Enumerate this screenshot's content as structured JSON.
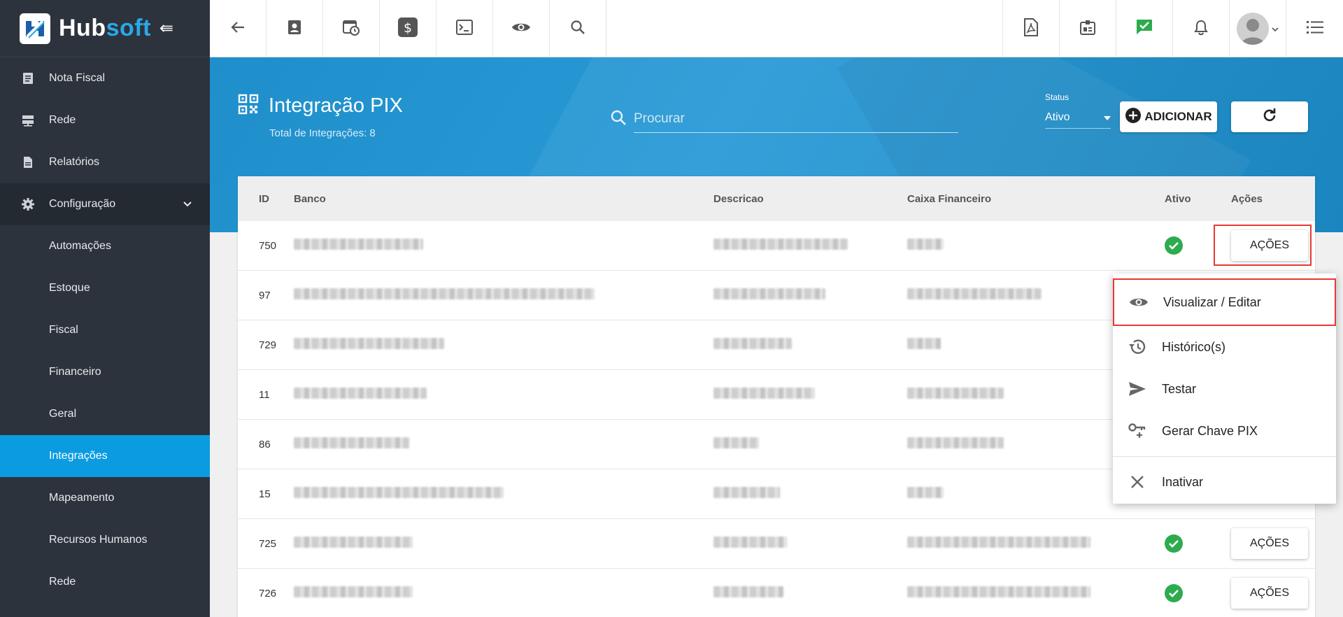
{
  "brand": {
    "name_part1": "Hub",
    "name_part2": "soft"
  },
  "sidebar": {
    "items": [
      {
        "label": "Nota Fiscal",
        "icon": "invoice-icon"
      },
      {
        "label": "Rede",
        "icon": "server-icon"
      },
      {
        "label": "Relatórios",
        "icon": "report-icon"
      },
      {
        "label": "Configuração",
        "icon": "gear-icon"
      }
    ],
    "subitems": [
      {
        "label": "Automações"
      },
      {
        "label": "Estoque"
      },
      {
        "label": "Fiscal"
      },
      {
        "label": "Financeiro"
      },
      {
        "label": "Geral"
      },
      {
        "label": "Integrações",
        "active": true
      },
      {
        "label": "Mapeamento"
      },
      {
        "label": "Recursos Humanos"
      },
      {
        "label": "Rede"
      }
    ]
  },
  "header": {
    "title": "Integração PIX",
    "subtitle": "Total de Integrações: 8",
    "search_placeholder": "Procurar",
    "status_label": "Status",
    "status_value": "Ativo",
    "add_label": "ADICIONAR"
  },
  "table": {
    "columns": {
      "id": "ID",
      "banco": "Banco",
      "descricao": "Descricao",
      "caixa": "Caixa Financeiro",
      "ativo": "Ativo",
      "acoes": "Ações"
    },
    "action_label": "AÇÕES",
    "rows": [
      {
        "id": "750"
      },
      {
        "id": "97"
      },
      {
        "id": "729"
      },
      {
        "id": "11"
      },
      {
        "id": "86"
      },
      {
        "id": "15"
      },
      {
        "id": "725"
      },
      {
        "id": "726"
      }
    ]
  },
  "dropdown": {
    "items": [
      {
        "label": "Visualizar / Editar",
        "icon": "eye-icon"
      },
      {
        "label": "Histórico(s)",
        "icon": "history-icon"
      },
      {
        "label": "Testar",
        "icon": "send-icon"
      },
      {
        "label": "Gerar Chave PIX",
        "icon": "key-icon"
      },
      {
        "label": "Inativar",
        "icon": "close-icon"
      }
    ]
  },
  "colors": {
    "sidebar_bg": "#2c333c",
    "accent": "#0a9be0",
    "band": "#2a9ad6",
    "success": "#2dab4f",
    "highlight": "#e53935"
  }
}
